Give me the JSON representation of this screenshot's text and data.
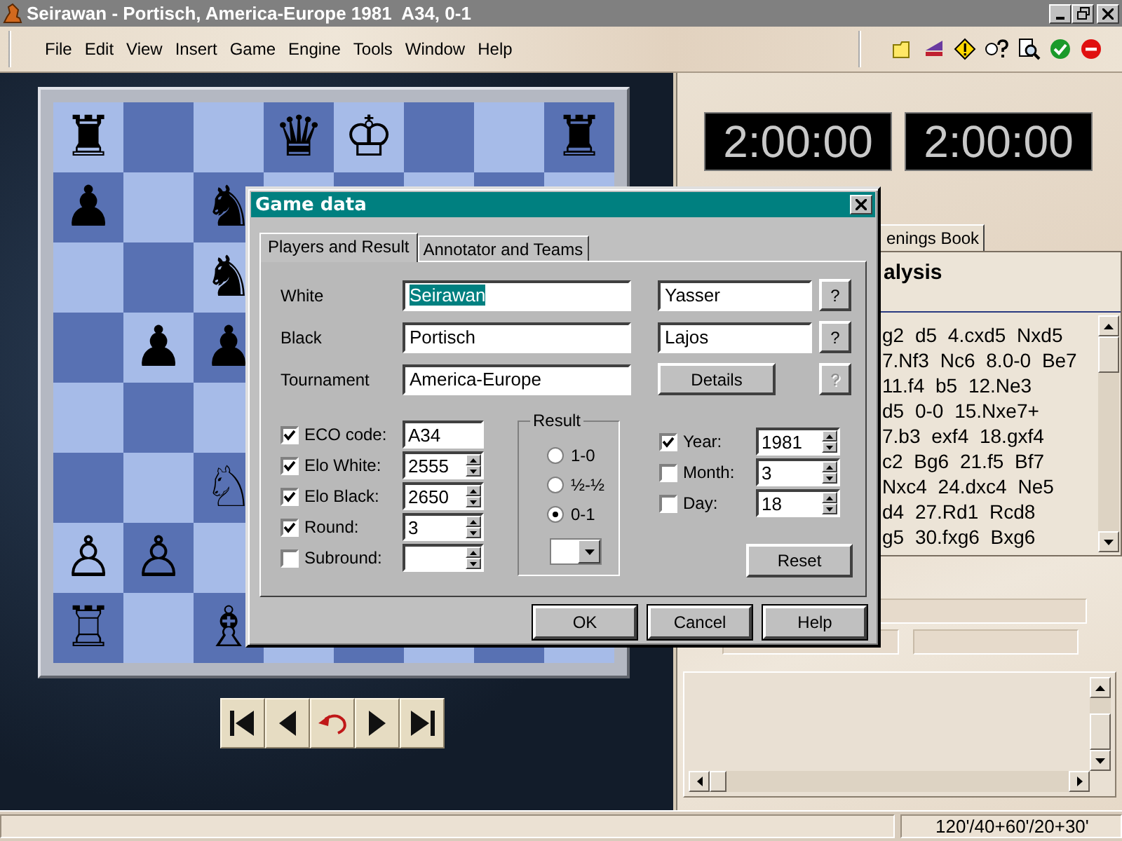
{
  "window": {
    "title": "Seirawan - Portisch, America-Europe 1981  A34, 0-1"
  },
  "menu": [
    "File",
    "Edit",
    "View",
    "Insert",
    "Game",
    "Engine",
    "Tools",
    "Window",
    "Help"
  ],
  "board": {
    "rows": [
      [
        "♜",
        null,
        null,
        "♛",
        "♔",
        null,
        null,
        "♜"
      ],
      [
        "♟",
        null,
        "♞",
        null,
        null,
        null,
        null,
        null
      ],
      [
        null,
        null,
        "♞",
        null,
        null,
        null,
        null,
        null
      ],
      [
        null,
        "♟",
        "♟",
        null,
        null,
        null,
        null,
        null
      ],
      [
        null,
        null,
        null,
        null,
        null,
        null,
        null,
        null
      ],
      [
        null,
        null,
        "♘",
        null,
        null,
        null,
        null,
        null
      ],
      [
        "♙",
        "♙",
        null,
        null,
        null,
        null,
        null,
        null
      ],
      [
        "♖",
        null,
        "♗",
        null,
        null,
        null,
        null,
        null
      ]
    ]
  },
  "clocks": [
    "2:00:00",
    "2:00:00"
  ],
  "notation": {
    "tab": "enings Book",
    "heading": "alysis",
    "lines": [
      "g2 d5 4.cxd5 Nxd5",
      "7.Nf3 Nc6 8.0-0 Be7",
      "11.f4 b5 12.Ne3",
      "d5 0-0 15.Nxe7+",
      "7.b3 exf4 18.gxf4",
      "c2 Bg6 21.f5 Bf7",
      "Nxc4 24.dxc4 Ne5",
      "d4 27.Rd1 Rcd8",
      "g5 30.fxg6 Bxg6"
    ]
  },
  "status_bar": {
    "time_control": "120'/40+60'/20+30'"
  },
  "dialog": {
    "title": "Game data",
    "tabs": [
      {
        "label": "Players and Result",
        "selected": true
      },
      {
        "label": "Annotator and Teams",
        "selected": false
      }
    ],
    "players": [
      {
        "label": "White",
        "surname": "Seirawan",
        "surname_selected": true,
        "first_name": "Yasser",
        "help": "?"
      },
      {
        "label": "Black",
        "surname": "Portisch",
        "surname_selected": false,
        "first_name": "Lajos",
        "help": "?"
      }
    ],
    "tournament": {
      "label": "Tournament",
      "value": "America-Europe",
      "details": "Details",
      "help": "?",
      "help_disabled": true
    },
    "options": [
      {
        "label": "ECO code:",
        "checked": true,
        "value": "A34",
        "kind": "text"
      },
      {
        "label": "Elo White:",
        "checked": true,
        "value": "2555",
        "kind": "spin"
      },
      {
        "label": "Elo Black:",
        "checked": true,
        "value": "2650",
        "kind": "spin"
      },
      {
        "label": "Round:",
        "checked": true,
        "value": "3",
        "kind": "spin"
      },
      {
        "label": "Subround:",
        "checked": false,
        "kind": "spin"
      }
    ],
    "result": {
      "title": "Result",
      "choices": [
        {
          "label": "1-0",
          "selected": false
        },
        {
          "label": "½-½",
          "selected": false
        },
        {
          "label": "0-1",
          "selected": true
        }
      ]
    },
    "date": [
      {
        "label": "Year:",
        "checked": true,
        "value": "1981"
      },
      {
        "label": "Month:",
        "checked": false,
        "value": "3"
      },
      {
        "label": "Day:",
        "checked": false,
        "value": "18"
      }
    ],
    "reset": "Reset",
    "buttons": [
      "OK",
      "Cancel",
      "Help"
    ]
  }
}
